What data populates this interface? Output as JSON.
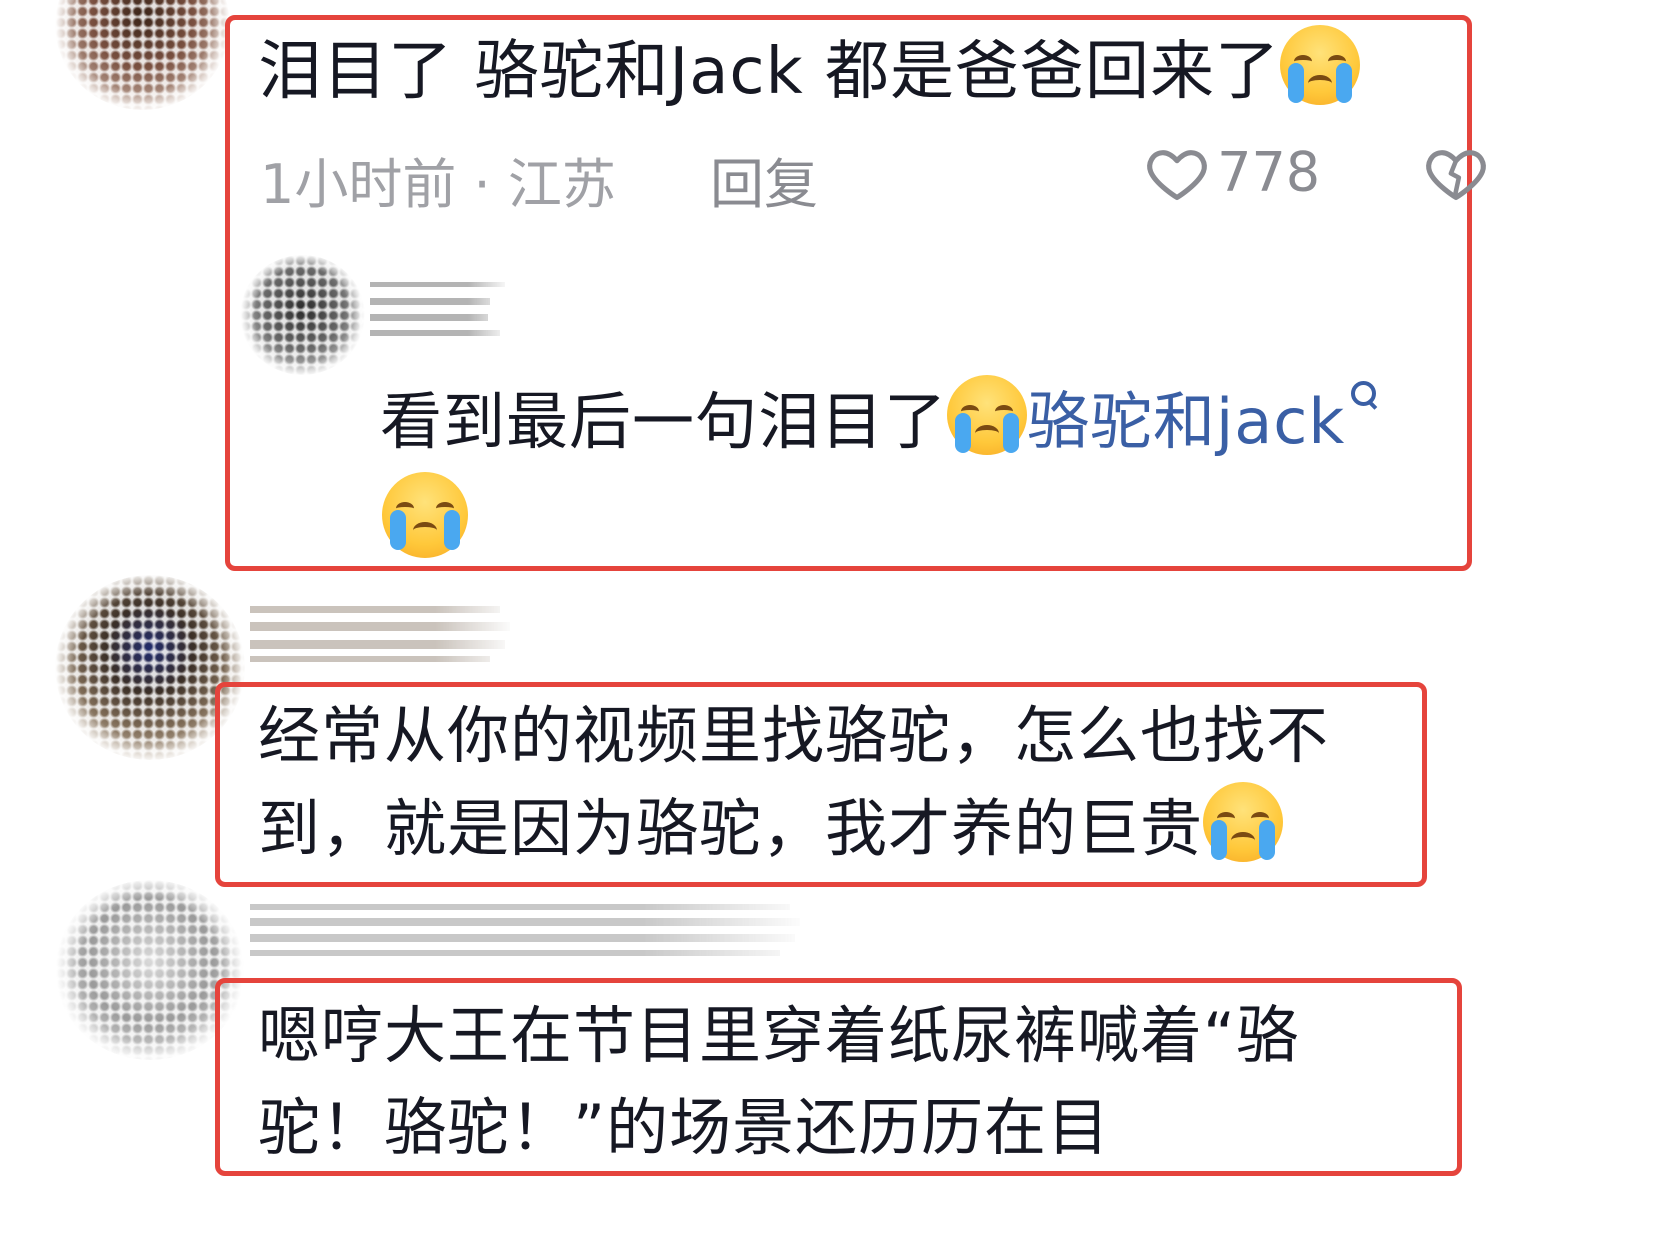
{
  "comments": [
    {
      "text": "泪目了 骆驼和Jack 都是爸爸回来了",
      "time_location": "1小时前 · 江苏",
      "reply_label": "回复",
      "like_count": "778",
      "reply": {
        "text": "看到最后一句泪目了",
        "link_text": "骆驼和jack"
      }
    },
    {
      "line1": "经常从你的视频里找骆驼，怎么也找不",
      "line2": "到，就是因为骆驼，我才养的巨贵"
    },
    {
      "line1": "嗯哼大王在节目里穿着纸尿裤喊着“骆",
      "line2": "驼！骆驼！”的场景还历历在目"
    }
  ],
  "icons": {
    "emoji": "loudly-crying-face-emoji",
    "like": "heart-icon",
    "dislike": "broken-heart-icon",
    "search": "search-icon"
  },
  "colors": {
    "highlight": "#e5443c",
    "link": "#3a5fa5",
    "meta": "#a0a1a6"
  }
}
